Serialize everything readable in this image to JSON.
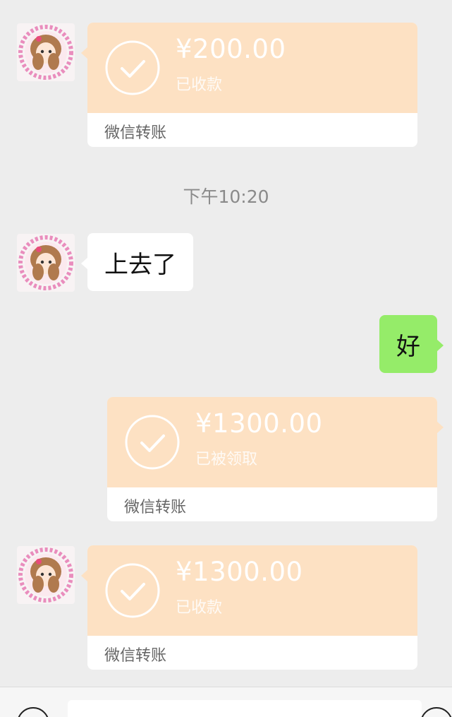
{
  "messages": [
    {
      "type": "transfer",
      "direction": "incoming",
      "amount": "¥200.00",
      "status": "已收款",
      "footer": "微信转账"
    },
    {
      "type": "timestamp",
      "text": "下午10:20"
    },
    {
      "type": "text",
      "direction": "incoming",
      "text": "上去了"
    },
    {
      "type": "text",
      "direction": "outgoing",
      "text": "好"
    },
    {
      "type": "transfer",
      "direction": "outgoing",
      "amount": "¥1300.00",
      "status": "已被领取",
      "footer": "微信转账"
    },
    {
      "type": "transfer",
      "direction": "incoming",
      "amount": "¥1300.00",
      "status": "已收款",
      "footer": "微信转账"
    }
  ],
  "input_bar": {
    "value": "",
    "placeholder": "",
    "left_icon": "voice-icon",
    "right_icon": "emoji-icon"
  },
  "colors": {
    "background": "#ededed",
    "transfer_card": "#fde1c3",
    "outgoing_bubble": "#95ec69",
    "incoming_bubble": "#ffffff"
  }
}
